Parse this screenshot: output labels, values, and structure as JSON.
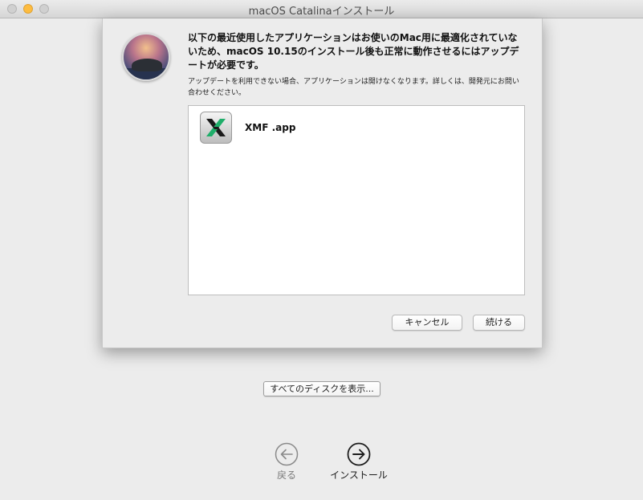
{
  "window": {
    "title": "macOS Catalinaインストール"
  },
  "sheet": {
    "heading": "以下の最近使用したアプリケーションはお使いのMac用に最適化されていないため、macOS 10.15のインストール後も正常に動作させるにはアップデートが必要です。",
    "subtext": "アップデートを利用できない場合、アプリケーションは開けなくなります。詳しくは、開発元にお問い合わせください。",
    "apps": [
      {
        "name": "XMF .app",
        "icon": "xmf-app-icon"
      }
    ],
    "buttons": {
      "cancel": "キャンセル",
      "continue": "続ける"
    }
  },
  "main": {
    "show_all_disks": "すべてのディスクを表示..."
  },
  "nav": {
    "back_label": "戻る",
    "install_label": "インストール"
  },
  "colors": {
    "minimize": "#fdbc40",
    "xmf_green": "#1fae6a"
  }
}
